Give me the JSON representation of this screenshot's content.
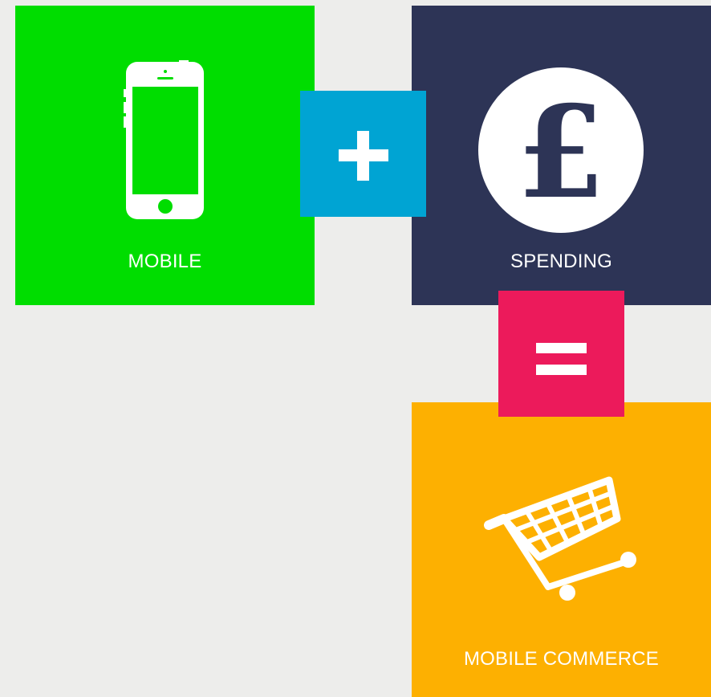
{
  "colors": {
    "background": "#ededeb",
    "mobile": "#00dd00",
    "spending": "#2d3456",
    "commerce": "#fdb001",
    "plus": "#00a4d3",
    "equals": "#ec1a5b",
    "icon": "#ffffff"
  },
  "tiles": {
    "mobile": {
      "label": "MOBILE",
      "icon": "smartphone-icon"
    },
    "spending": {
      "label": "SPENDING",
      "icon": "pound-sign-icon",
      "symbol": "£"
    },
    "commerce": {
      "label": "MOBILE COMMERCE",
      "icon": "shopping-cart-icon"
    }
  },
  "operators": {
    "plus": {
      "symbol": "plus-icon"
    },
    "equals": {
      "symbol": "equals-icon"
    }
  }
}
